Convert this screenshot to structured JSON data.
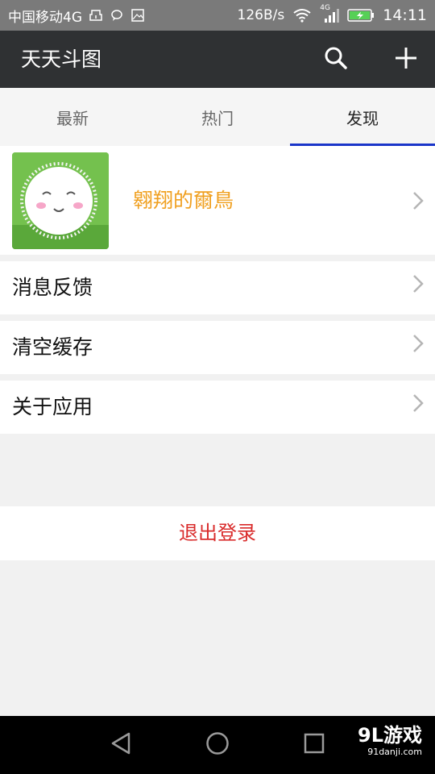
{
  "status_bar": {
    "carrier": "中国移动4G",
    "speed": "126B/s",
    "network_type": "4G",
    "time": "14:11",
    "icons": [
      "usb-icon",
      "chat-bubble-icon",
      "image-icon",
      "wifi-icon",
      "signal-icon",
      "battery-charging-icon"
    ]
  },
  "app_bar": {
    "title": "天天斗图",
    "actions": [
      "search-icon",
      "plus-icon"
    ]
  },
  "tabs": [
    {
      "label": "最新",
      "active": false
    },
    {
      "label": "热门",
      "active": false
    },
    {
      "label": "发现",
      "active": true
    }
  ],
  "profile": {
    "name": "翱翔的爾鳥"
  },
  "menu": {
    "items": [
      {
        "label": "消息反馈"
      },
      {
        "label": "清空缓存"
      },
      {
        "label": "关于应用"
      }
    ],
    "logout_label": "退出登录"
  },
  "watermark": {
    "brand": "9L游戏",
    "domain": "91danji.com"
  },
  "colors": {
    "app_bar": "#2f3133",
    "status_bar": "#7a7a7a",
    "tab_indicator": "#1a35c9",
    "profile_name": "#f0a020",
    "logout": "#d92b2b",
    "background": "#f1f1f1"
  },
  "nav_icons": [
    "back-icon",
    "home-icon",
    "recents-icon"
  ]
}
